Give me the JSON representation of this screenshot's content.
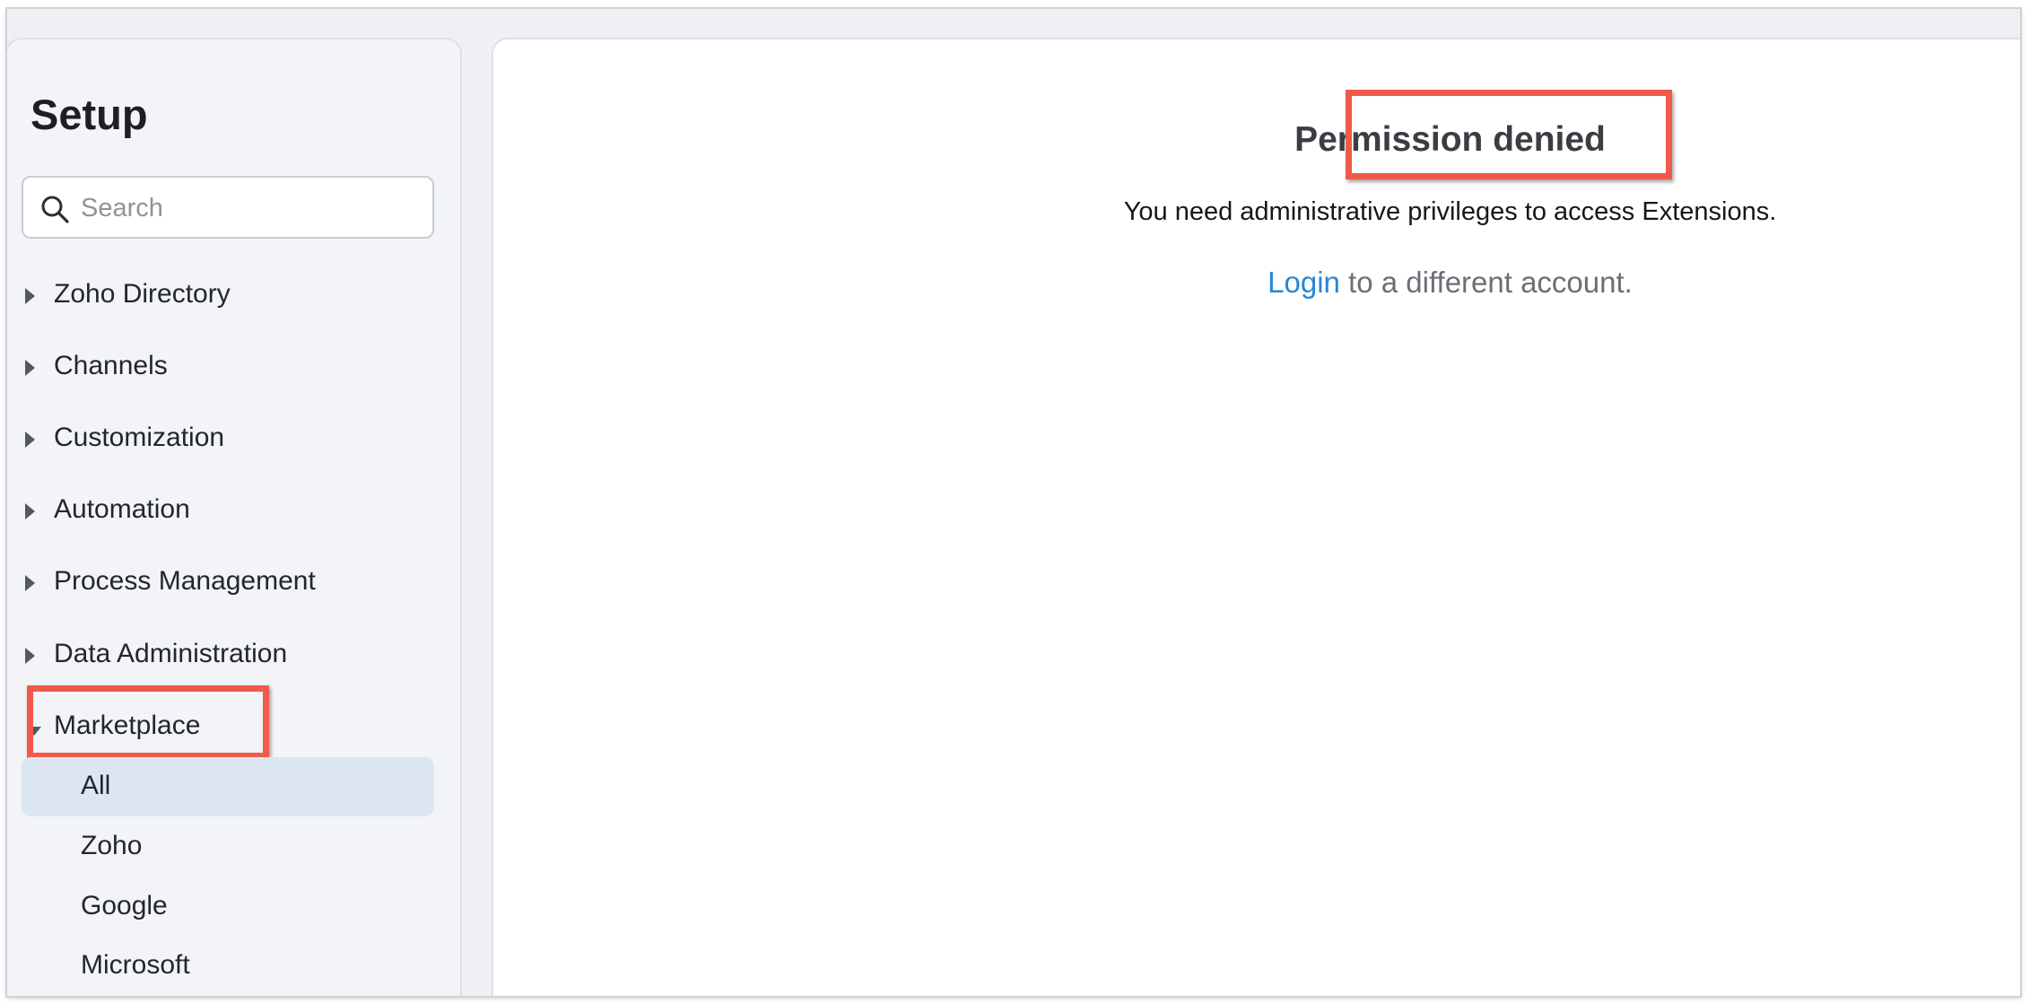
{
  "sidebar": {
    "title": "Setup",
    "search": {
      "placeholder": "Search",
      "value": ""
    },
    "items": [
      {
        "label": "Zoho Directory",
        "expanded": false
      },
      {
        "label": "Channels",
        "expanded": false
      },
      {
        "label": "Customization",
        "expanded": false
      },
      {
        "label": "Automation",
        "expanded": false
      },
      {
        "label": "Process Management",
        "expanded": false
      },
      {
        "label": "Data Administration",
        "expanded": false
      },
      {
        "label": "Marketplace",
        "expanded": true
      }
    ],
    "marketplace_subitems": [
      {
        "label": "All",
        "active": true
      },
      {
        "label": "Zoho",
        "active": false
      },
      {
        "label": "Google",
        "active": false
      },
      {
        "label": "Microsoft",
        "active": false
      }
    ]
  },
  "main": {
    "title": "Permission denied",
    "message": "You need administrative privileges to access Extensions.",
    "login_link": "Login",
    "login_suffix": " to a different account."
  },
  "colors": {
    "accent_link": "#2a86d6",
    "highlight_box": "#ef5a4a",
    "active_item_bg": "#dce6f3"
  }
}
